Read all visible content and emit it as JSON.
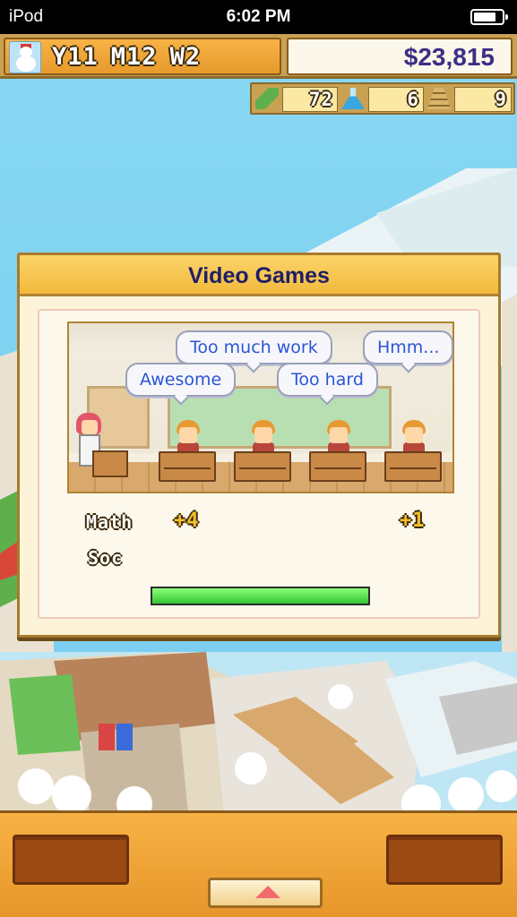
{
  "status_bar": {
    "carrier": "iPod",
    "time": "6:02 PM"
  },
  "hud": {
    "year": "Y11",
    "month": "M12",
    "week": "W2",
    "money": "$23,815",
    "season_icon": "snowman-icon"
  },
  "resources": [
    {
      "icon": "pencil-icon",
      "value": "72"
    },
    {
      "icon": "flask-icon",
      "value": "6"
    },
    {
      "icon": "book-stack-icon",
      "value": "9"
    }
  ],
  "dialog": {
    "title": "Video Games",
    "bubbles": [
      "Too much work",
      "Hmm...",
      "Awesome",
      "Too hard"
    ],
    "stats": [
      {
        "label": "Math",
        "left_value": "+4",
        "right_value": "+1"
      },
      {
        "label": "Soc",
        "left_value": "",
        "right_value": ""
      }
    ],
    "progress": 1.0
  },
  "bottom_bar": {
    "toggle_icon": "up-arrow-icon"
  }
}
